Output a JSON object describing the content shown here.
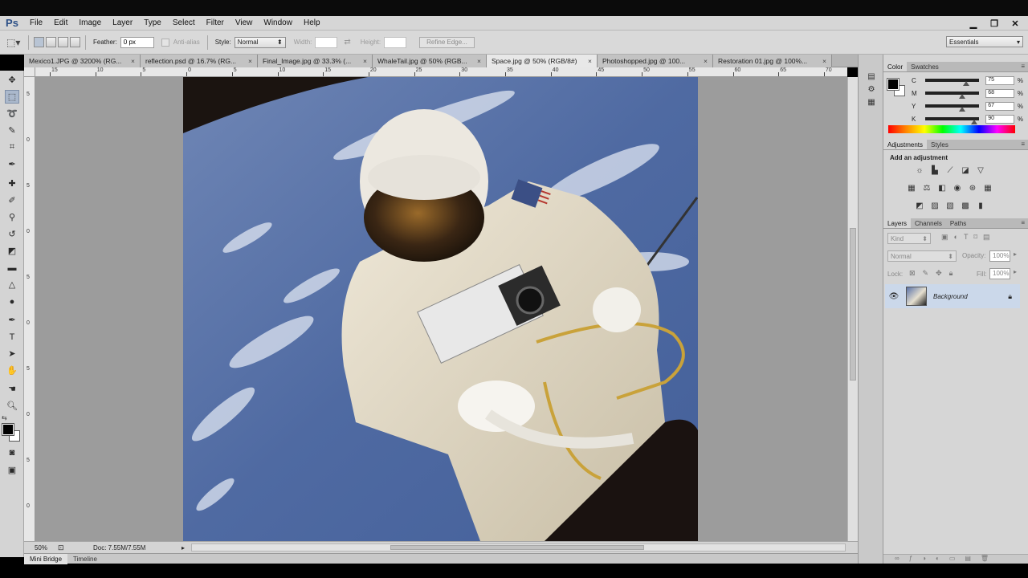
{
  "app": {
    "logo": "Ps"
  },
  "menu": [
    "File",
    "Edit",
    "Image",
    "Layer",
    "Type",
    "Select",
    "Filter",
    "View",
    "Window",
    "Help"
  ],
  "window_controls": [
    "minimize",
    "restore",
    "close"
  ],
  "options": {
    "feather_label": "Feather:",
    "feather_value": "0 px",
    "antialias_label": "Anti-alias",
    "style_label": "Style:",
    "style_value": "Normal",
    "width_label": "Width:",
    "height_label": "Height:",
    "refine_label": "Refine Edge...",
    "workspace": "Essentials"
  },
  "tabs": [
    {
      "label": "Mexico1.JPG @ 3200% (RG..."
    },
    {
      "label": "reflection.psd @ 16.7% (RG..."
    },
    {
      "label": "Final_Image.jpg @ 33.3% (..."
    },
    {
      "label": "WhaleTail.jpg @ 50% (RGB..."
    },
    {
      "label": "Space.jpg @ 50% (RGB/8#)",
      "active": true
    },
    {
      "label": "Photoshopped.jpg @ 100..."
    },
    {
      "label": "Restoration 01.jpg @ 100%..."
    }
  ],
  "ruler": {
    "h": [
      "15",
      "10",
      "5",
      "0",
      "5",
      "10",
      "15",
      "20",
      "25",
      "30",
      "35",
      "40",
      "45",
      "50",
      "55",
      "60",
      "65",
      "70"
    ],
    "v": [
      "5",
      "0",
      "5",
      "0",
      "5",
      "0",
      "5",
      "0",
      "5",
      "0",
      "5"
    ]
  },
  "status": {
    "zoom": "50%",
    "doc": "Doc: 7.55M/7.55M"
  },
  "bottom_tabs": [
    "Mini Bridge",
    "Timeline"
  ],
  "color_panel": {
    "tabs": [
      "Color",
      "Swatches"
    ],
    "sliders": [
      {
        "label": "C",
        "value": "75",
        "pct": "%",
        "level": 0.75
      },
      {
        "label": "M",
        "value": "68",
        "pct": "%",
        "level": 0.68
      },
      {
        "label": "Y",
        "value": "67",
        "pct": "%",
        "level": 0.67
      },
      {
        "label": "K",
        "value": "90",
        "pct": "%",
        "level": 0.9
      }
    ]
  },
  "adjustments": {
    "tabs": [
      "Adjustments",
      "Styles"
    ],
    "heading": "Add an adjustment"
  },
  "layers": {
    "tabs": [
      "Layers",
      "Channels",
      "Paths"
    ],
    "kind": "Kind",
    "blend": "Normal",
    "opacity_label": "Opacity:",
    "opacity_value": "100%",
    "lock_label": "Lock:",
    "fill_label": "Fill:",
    "fill_value": "100%",
    "layer_name": "Background"
  },
  "colors": {
    "accent": "#cbd8ea",
    "menubar": "#d6d6d6"
  }
}
